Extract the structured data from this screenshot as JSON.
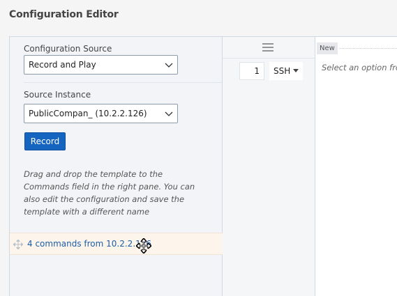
{
  "page": {
    "title": "Configuration Editor"
  },
  "left": {
    "config_source": {
      "label": "Configuration Source",
      "value": "Record and Play"
    },
    "source_instance": {
      "label": "Source Instance",
      "value": "PublicCompan_ (10.2.2.126)"
    },
    "record_label": "Record",
    "hint": "Drag and drop the template to the Commands field in the right pane. You can also edit the configuration and save the template with a different name",
    "command_item": "4 commands from 10.2.2.126"
  },
  "middle": {
    "line_number": "1",
    "protocol": "SSH"
  },
  "right": {
    "tag": "New",
    "placeholder": "Select an option from"
  },
  "colors": {
    "accent": "#1565c0",
    "link": "#1a5fa8",
    "drag_row_bg": "#fdf4ec"
  },
  "icons": [
    "chevron-down-icon",
    "move-icon",
    "move-cursor-icon",
    "hamburger-menu-icon",
    "caret-down-icon"
  ]
}
